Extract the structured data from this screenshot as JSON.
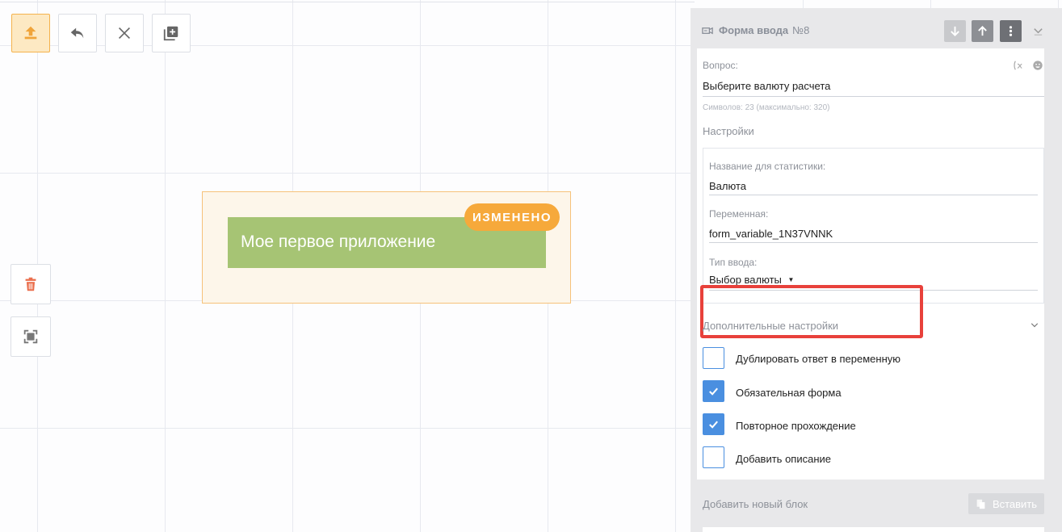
{
  "toolbar": {
    "icons": [
      "upload-icon",
      "undo-icon",
      "close-icon",
      "add-copy-icon"
    ]
  },
  "sidetools": {
    "icons": [
      "trash-icon",
      "fit-screen-icon"
    ]
  },
  "block": {
    "title": "Мое первое приложение",
    "badge": "ИЗМЕНЕНО"
  },
  "panel": {
    "title": "Форма ввода",
    "number": "№8",
    "question_label": "Вопрос:",
    "question_value": "Выберите валюту расчета",
    "chars_hint": "Символов: 23 (максимально: 320)",
    "settings_label": "Настройки",
    "stat_name_label": "Название для статистики:",
    "stat_name_value": "Валюта",
    "variable_label": "Переменная:",
    "variable_value": "form_variable_1N37VNNK",
    "input_type_label": "Тип ввода:",
    "input_type_value": "Выбор валюты",
    "additional_label": "Дополнительные настройки",
    "checkboxes": [
      {
        "label": "Дублировать ответ в переменную",
        "checked": false
      },
      {
        "label": "Обязательная форма",
        "checked": true
      },
      {
        "label": "Повторное прохождение",
        "checked": true
      },
      {
        "label": "Добавить описание",
        "checked": false
      }
    ],
    "add_block_label": "Добавить новый блок",
    "paste_label": "Вставить"
  },
  "colors": {
    "accent_orange": "#f6a93b",
    "block_green": "#a6c474",
    "checkbox_blue": "#4a8fe0",
    "highlight_red": "#e8413b"
  }
}
